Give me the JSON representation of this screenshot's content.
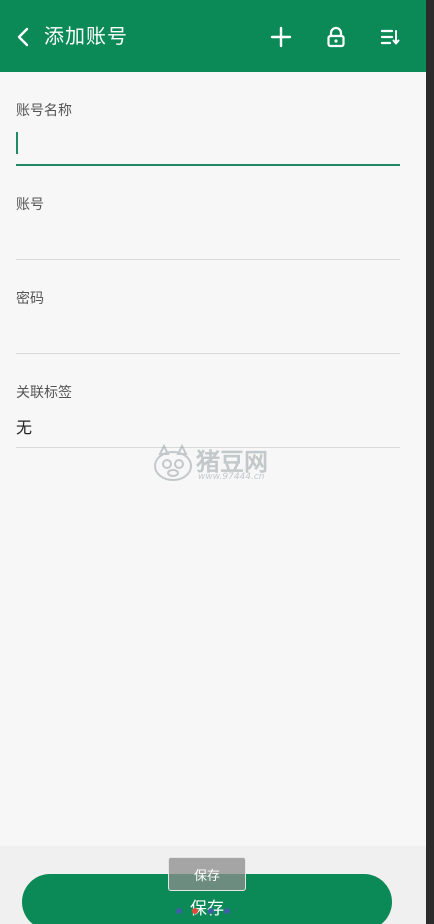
{
  "header": {
    "title": "添加账号",
    "bg_color": "#0b8a57",
    "icons": [
      "back-arrow",
      "plus",
      "lock",
      "sort-menu"
    ]
  },
  "form": {
    "fields": [
      {
        "label": "账号名称",
        "value": "",
        "focused": true
      },
      {
        "label": "账号",
        "value": ""
      },
      {
        "label": "密码",
        "value": ""
      },
      {
        "label": "关联标签",
        "value": "无"
      }
    ]
  },
  "watermark": {
    "brand": "猪豆网",
    "url": "www.97444.cn"
  },
  "footer": {
    "save_label": "保存",
    "tooltip_label": "保存",
    "dot_colors": [
      "#3f5fa5",
      "#e04a3a",
      "#3f5fa5",
      "#3f5fa5"
    ]
  }
}
